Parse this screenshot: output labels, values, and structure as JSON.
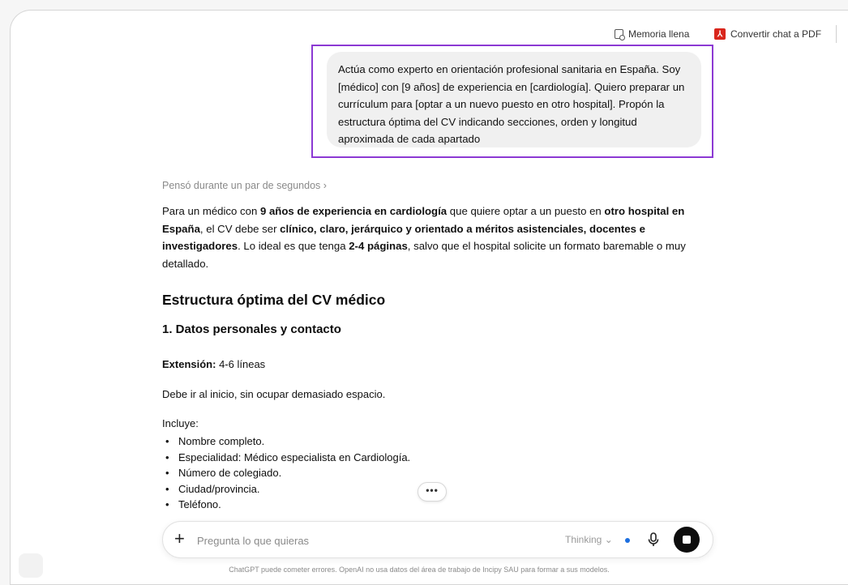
{
  "topbar": {
    "memory_label": "Memoria llena",
    "pdf_label": "Convertir chat a PDF"
  },
  "user_message": "Actúa como experto en orientación profesional sanitaria en España. Soy [médico] con [9 años] de experiencia en [cardiología]. Quiero preparar un currículum para [optar a un nuevo puesto en otro hospital]. Propón la estructura óptima del CV indicando secciones, orden y longitud aproximada de cada apartado",
  "assistant": {
    "thought_label": "Pensó durante un par de segundos",
    "intro": {
      "t1": "Para un médico con ",
      "b1": "9 años de experiencia en cardiología",
      "t2": " que quiere optar a un puesto en ",
      "b2": "otro hospital en España",
      "t3": ", el CV debe ser ",
      "b3": "clínico, claro, jerárquico y orientado a méritos asistenciales, docentes e investigadores",
      "t4": ". Lo ideal es que tenga ",
      "b4": "2-4 páginas",
      "t5": ", salvo que el hospital solicite un formato baremable o muy detallado."
    },
    "heading": "Estructura óptima del CV médico",
    "section1_title": "1. Datos personales y contacto",
    "extension_label": "Extensión:",
    "extension_value": " 4-6 líneas",
    "section1_note": "Debe ir al inicio, sin ocupar demasiado espacio.",
    "includes_label": "Incluye:",
    "items": [
      "Nombre completo.",
      "Especialidad: Médico especialista en Cardiología.",
      "Número de colegiado.",
      "Ciudad/provincia.",
      "Teléfono."
    ]
  },
  "composer": {
    "placeholder": "Pregunta lo que quieras",
    "model_label": "Thinking",
    "more_label": "•••"
  },
  "disclaimer": "ChatGPT puede cometer errores. OpenAI no usa datos del área de trabajo de Incipy SAU para formar a sus modelos."
}
